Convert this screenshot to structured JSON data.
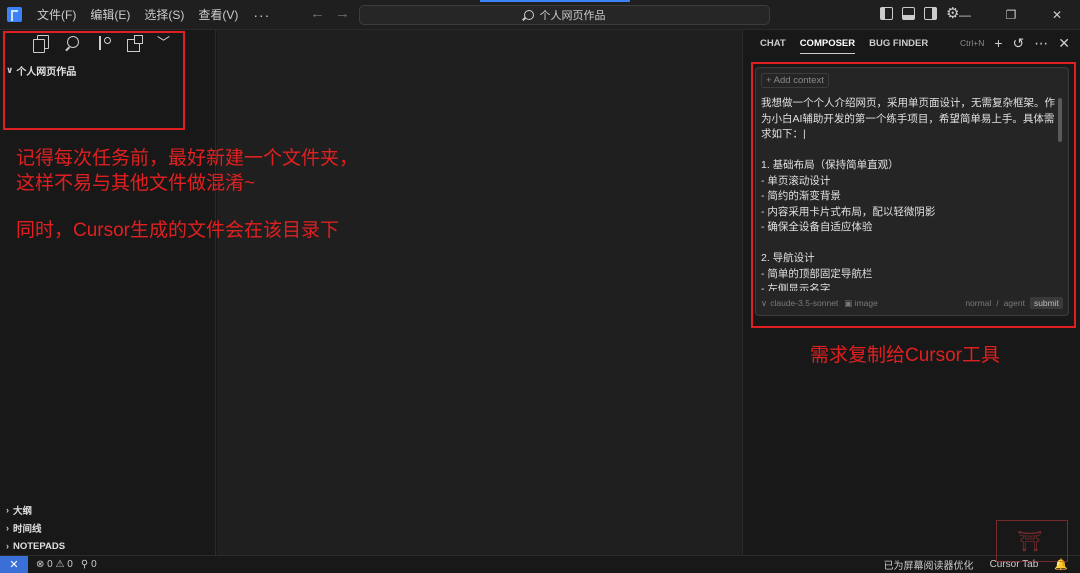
{
  "menu": {
    "items": [
      "文件(F)",
      "编辑(E)",
      "选择(S)",
      "查看(V)"
    ],
    "more": "···"
  },
  "nav": {
    "back": "←",
    "forward": "→"
  },
  "search": {
    "text": "个人网页作品"
  },
  "window_controls": {
    "minimize": "—",
    "restore": "❐",
    "close": "✕"
  },
  "sidebar": {
    "folder_name": "个人网页作品",
    "sections": [
      "大纲",
      "时间线",
      "NOTEPADS"
    ]
  },
  "annotations": {
    "left_note_line1": "记得每次任务前，最好新建一个文件夹，",
    "left_note_line2": "这样不易与其他文件做混淆~",
    "left_note_line3": "同时，Cursor生成的文件会在该目录下",
    "right_note": "需求复制给Cursor工具"
  },
  "chat": {
    "tabs": [
      "CHAT",
      "COMPOSER",
      "BUG FINDER"
    ],
    "active_tab": "COMPOSER",
    "shortcut": "Ctrl+N",
    "add_context": "+ Add context",
    "prompt": "我想做一个个人介绍网页，采用单页面设计，无需复杂框架。作为小白AI辅助开发的第一个练手项目，希望简单易上手。具体需求如下：|\n\n1. 基础布局（保持简单直观）\n- 单页滚动设计\n- 简约的渐变背景\n- 内容采用卡片式布局，配以轻微阴影\n- 确保全设备自适应体验\n\n2. 导航设计\n- 简单的顶部固定导航栏\n- 左侧显示名字",
    "model": "claude-3.5-sonnet",
    "image_label": "image",
    "mode_normal": "normal",
    "mode_separator": "/",
    "mode_agent": "agent",
    "submit": "submit"
  },
  "statusbar": {
    "remote": "✕",
    "problems": "⊗ 0 ⚠ 0",
    "ports": "0",
    "screen_reader": "已为屏幕阅读器优化",
    "cursor_tab": "Cursor Tab"
  },
  "colors": {
    "annotation_red": "#e02020",
    "accent_blue": "#3b6fd8"
  }
}
